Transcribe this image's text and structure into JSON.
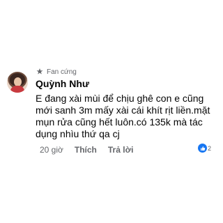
{
  "comment": {
    "badge": "Fan cứng",
    "author": "Quỳnh Như",
    "text": "E đang xài mùi để chịu ghê con e cũng mới sanh 3m mấy xài cái khít rịt liền.mặt mụn rửa cũng hết luôn.có 135k mà tác dụng nhìu thứ qa cj",
    "timestamp": "20 giờ",
    "like_label": "Thích",
    "reply_label": "Trả lời",
    "reaction_count": "2"
  },
  "colors": {
    "text": "#050505",
    "secondary": "#65676b",
    "like_blue": "#1877f2"
  },
  "icons": {
    "badge": "fan-badge-icon",
    "reaction": "like-icon"
  }
}
